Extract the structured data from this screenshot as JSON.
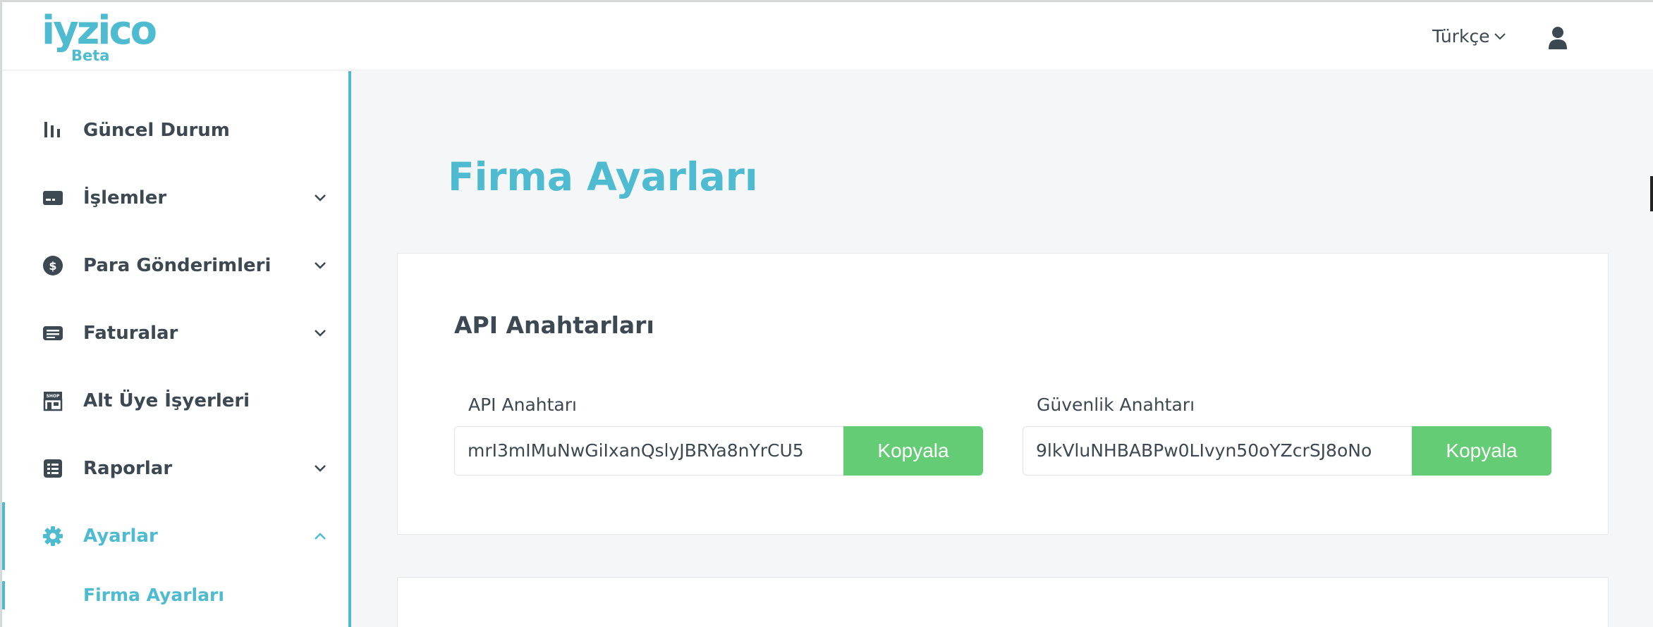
{
  "brand": {
    "name": "iyzico",
    "sub": "Beta",
    "color": "#4ebbd1"
  },
  "header": {
    "language": "Türkçe",
    "user_icon": "user-icon"
  },
  "sidebar": {
    "items": [
      {
        "label": "Güncel Durum",
        "icon": "chart-bars-icon",
        "has_chevron": false
      },
      {
        "label": "İşlemler",
        "icon": "credit-card-icon",
        "has_chevron": true
      },
      {
        "label": "Para Gönderimleri",
        "icon": "dollar-coin-icon",
        "has_chevron": true
      },
      {
        "label": "Faturalar",
        "icon": "invoice-icon",
        "has_chevron": true
      },
      {
        "label": "Alt Üye İşyerleri",
        "icon": "shop-icon",
        "has_chevron": false
      },
      {
        "label": "Raporlar",
        "icon": "report-icon",
        "has_chevron": true
      },
      {
        "label": "Ayarlar",
        "icon": "gear-icon",
        "has_chevron": true,
        "active": true,
        "expanded": true
      }
    ],
    "sub_items": [
      {
        "label": "Firma Ayarları",
        "active": true
      }
    ]
  },
  "main": {
    "title": "Firma Ayarları",
    "card": {
      "title": "API Anahtarları",
      "api_key": {
        "label": "API Anahtarı",
        "value": "mrI3mIMuNwGiIxanQslyJBRYa8nYrCU5",
        "button": "Kopyala"
      },
      "secret_key": {
        "label": "Güvenlik Anahtarı",
        "value": "9lkVluNHBABPw0LIvyn50oYZcrSJ8oNo",
        "button": "Kopyala"
      }
    }
  },
  "colors": {
    "accent": "#4ebbd1",
    "button": "#64cc74",
    "text": "#3c4852",
    "background": "#f5f6f8"
  }
}
